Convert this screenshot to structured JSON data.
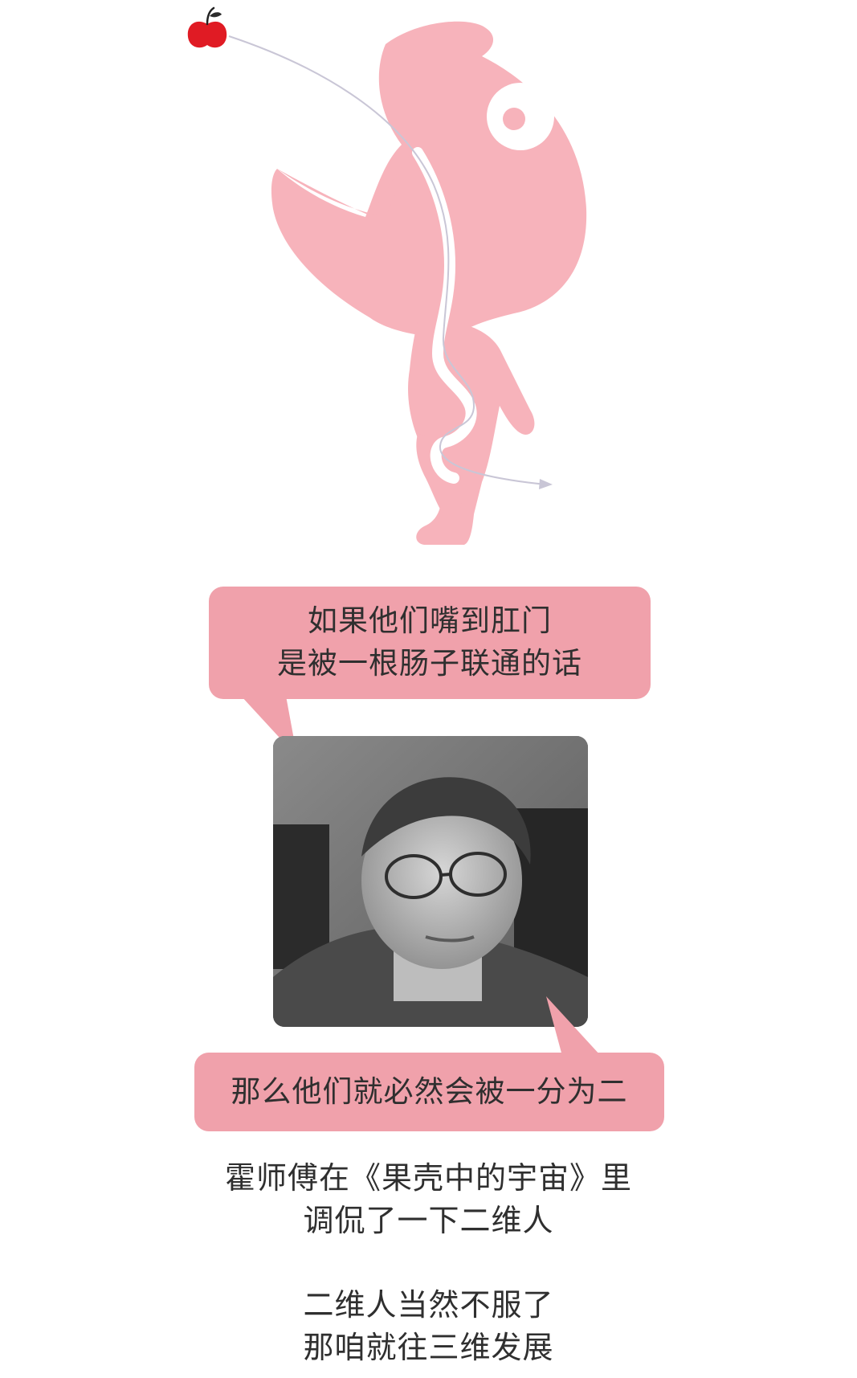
{
  "speech_top": {
    "line1": "如果他们嘴到肛门",
    "line2": "是被一根肠子联通的话"
  },
  "speech_bottom": {
    "line1": "那么他们就必然会被一分为二"
  },
  "caption_1": {
    "line1": "霍师傅在《果壳中的宇宙》里",
    "line2": "调侃了一下二维人"
  },
  "caption_2": {
    "line1": "二维人当然不服了",
    "line2": "那咱就往三维发展"
  },
  "colors": {
    "creature_pink": "#f7b3bb",
    "bubble_pink": "#f0a1ab",
    "apple_red": "#e01b24",
    "text": "#2f2f2f"
  },
  "icons": {
    "apple": "apple-icon",
    "creature": "two-dimensional-creature",
    "portrait": "portrait-photo"
  }
}
